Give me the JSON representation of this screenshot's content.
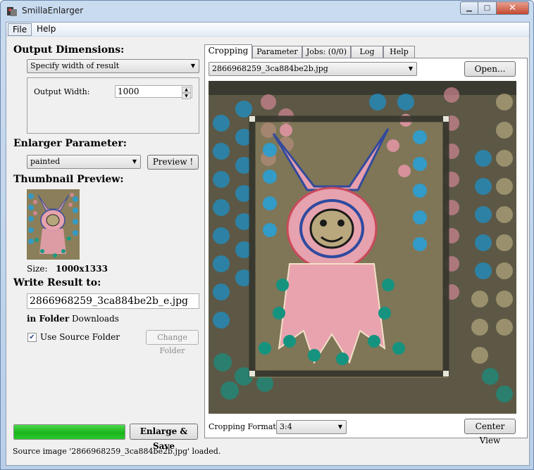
{
  "window": {
    "title": "SmillaEnlarger"
  },
  "menu": {
    "file": "File",
    "help": "Help"
  },
  "left": {
    "output_dimensions_title": "Output Dimensions:",
    "dimension_mode": "Specify width of result",
    "output_width_label": "Output Width:",
    "output_width_value": "1000",
    "enlarger_parameter_title": "Enlarger Parameter:",
    "preset": "painted",
    "preview_button": "Preview !",
    "thumbnail_title": "Thumbnail Preview:",
    "size_label": "Size:",
    "size_value": "1000x1333",
    "write_result_title": "Write Result to:",
    "output_filename": "2866968259_3ca884be2b_e.jpg",
    "in_folder_label": "in Folder",
    "folder_value": "Downloads",
    "use_source_folder_label": "Use Source Folder",
    "use_source_folder_checked": true,
    "change_folder_button": "Change Folder",
    "progress_percent": 100,
    "enlarge_save_button": "Enlarge & Save"
  },
  "right": {
    "tabs": [
      "Cropping",
      "Parameter",
      "Jobs: (0/0)",
      "Log",
      "Help"
    ],
    "active_tab": "Cropping",
    "source_file": "2866968259_3ca884be2b.jpg",
    "open_button": "Open...",
    "cropping_format_label": "Cropping Format:",
    "cropping_format_value": "3:4",
    "center_view_button": "Center View"
  },
  "status": {
    "message": "Source image '2866968259_3ca884be2b.jpg' loaded."
  },
  "colors": {
    "progress": "#1ab51a",
    "accent_frame": "#3a3a32"
  }
}
